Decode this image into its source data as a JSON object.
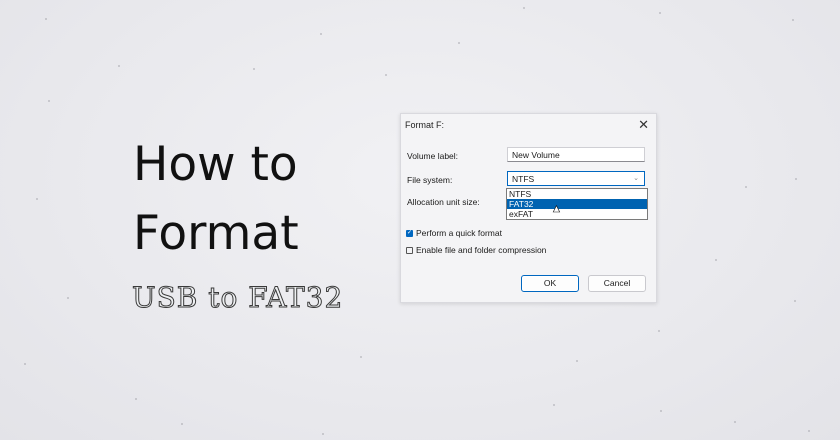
{
  "hero": {
    "line1": "How to",
    "line2": "Format",
    "subtitle": "USB to FAT32"
  },
  "dialog": {
    "title": "Format F:",
    "close_icon": "close-icon",
    "volume_label": {
      "label": "Volume label:",
      "value": "New Volume"
    },
    "file_system": {
      "label": "File system:",
      "value": "NTFS",
      "options": [
        "NTFS",
        "FAT32",
        "exFAT"
      ],
      "highlighted": "FAT32"
    },
    "allocation": {
      "label": "Allocation unit size:"
    },
    "quick_format": {
      "label": "Perform a quick format",
      "checked": true
    },
    "compression": {
      "label": "Enable file and folder compression",
      "checked": false
    },
    "ok_label": "OK",
    "cancel_label": "Cancel"
  },
  "colors": {
    "accent": "#0067c0",
    "selection": "#0063b1"
  }
}
